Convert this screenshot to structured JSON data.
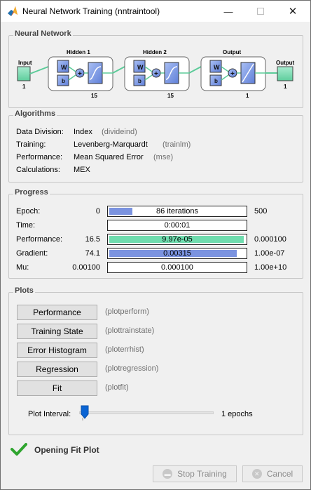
{
  "window": {
    "title": "Neural Network Training (nntraintool)"
  },
  "network": {
    "section_title": "Neural Network",
    "input_label": "Input",
    "input_size": "1",
    "hidden1_label": "Hidden 1",
    "hidden1_size": "15",
    "hidden2_label": "Hidden 2",
    "hidden2_size": "15",
    "output_layer_label": "Output",
    "output_layer_size": "1",
    "output_label": "Output",
    "output_size": "1",
    "weight_symbol": "W",
    "bias_symbol": "b",
    "sum_symbol": "+"
  },
  "algorithms": {
    "section_title": "Algorithms",
    "rows": [
      {
        "label": "Data Division:",
        "value": "Index",
        "func": "(divideind)"
      },
      {
        "label": "Training:",
        "value": "Levenberg-Marquardt",
        "func": "(trainlm)"
      },
      {
        "label": "Performance:",
        "value": "Mean Squared Error",
        "func": "(mse)"
      },
      {
        "label": "Calculations:",
        "value": "MEX",
        "func": ""
      }
    ]
  },
  "progress": {
    "section_title": "Progress",
    "epoch": {
      "label": "Epoch:",
      "start": "0",
      "text": "86 iterations",
      "end": "500",
      "fraction": 0.172
    },
    "time": {
      "label": "Time:",
      "text": "0:00:01"
    },
    "performance": {
      "label": "Performance:",
      "start": "16.5",
      "text": "9.97e-05",
      "end": "0.000100",
      "fraction": 1.0
    },
    "gradient": {
      "label": "Gradient:",
      "start": "74.1",
      "text": "0.00315",
      "end": "1.00e-07",
      "fraction": 0.946
    },
    "mu": {
      "label": "Mu:",
      "start": "0.00100",
      "text": "0.000100",
      "end": "1.00e+10",
      "fraction": 0.0
    }
  },
  "plots": {
    "section_title": "Plots",
    "buttons": [
      {
        "label": "Performance",
        "func": "(plotperform)"
      },
      {
        "label": "Training State",
        "func": "(plottrainstate)"
      },
      {
        "label": "Error Histogram",
        "func": "(ploterrhist)"
      },
      {
        "label": "Regression",
        "func": "(plotregression)"
      },
      {
        "label": "Fit",
        "func": "(plotfit)"
      }
    ],
    "interval_label": "Plot Interval:",
    "interval_value": "1 epochs"
  },
  "status": {
    "text": "Opening Fit Plot"
  },
  "footer": {
    "stop_label": "Stop Training",
    "cancel_label": "Cancel"
  },
  "colors": {
    "progress_blue": "#7b93e0",
    "progress_green": "#6fdcae",
    "layer_green": "#6ed6a8",
    "status_check": "#2fa52f"
  }
}
